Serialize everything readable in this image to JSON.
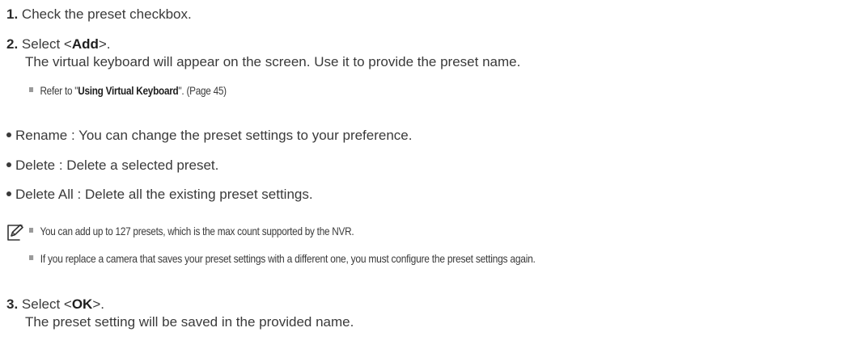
{
  "steps": {
    "s1": {
      "num": "1.",
      "text": "Check the preset checkbox."
    },
    "s2": {
      "num": "2.",
      "pre": "Select <",
      "bold": "Add",
      "post": ">.",
      "detail": "The virtual keyboard will appear on the screen. Use it to provide the preset name.",
      "ref_pre": "Refer to \"",
      "ref_bold": "Using Virtual Keyboard",
      "ref_post": "\". (Page 45)"
    },
    "s3": {
      "num": "3.",
      "pre": "Select <",
      "bold": "OK",
      "post": ">.",
      "detail": "The preset setting will be saved in the provided name."
    }
  },
  "bullets": [
    "Rename : You can change the preset settings to your preference.",
    "Delete : Delete a selected preset.",
    "Delete All : Delete all the existing preset settings."
  ],
  "notes": [
    "You can add up to 127 presets, which is the max count supported by the NVR.",
    "If you replace a camera that saves your preset settings with a different one, you must configure the preset settings again."
  ],
  "icons": {
    "note": "note-pencil-icon"
  }
}
